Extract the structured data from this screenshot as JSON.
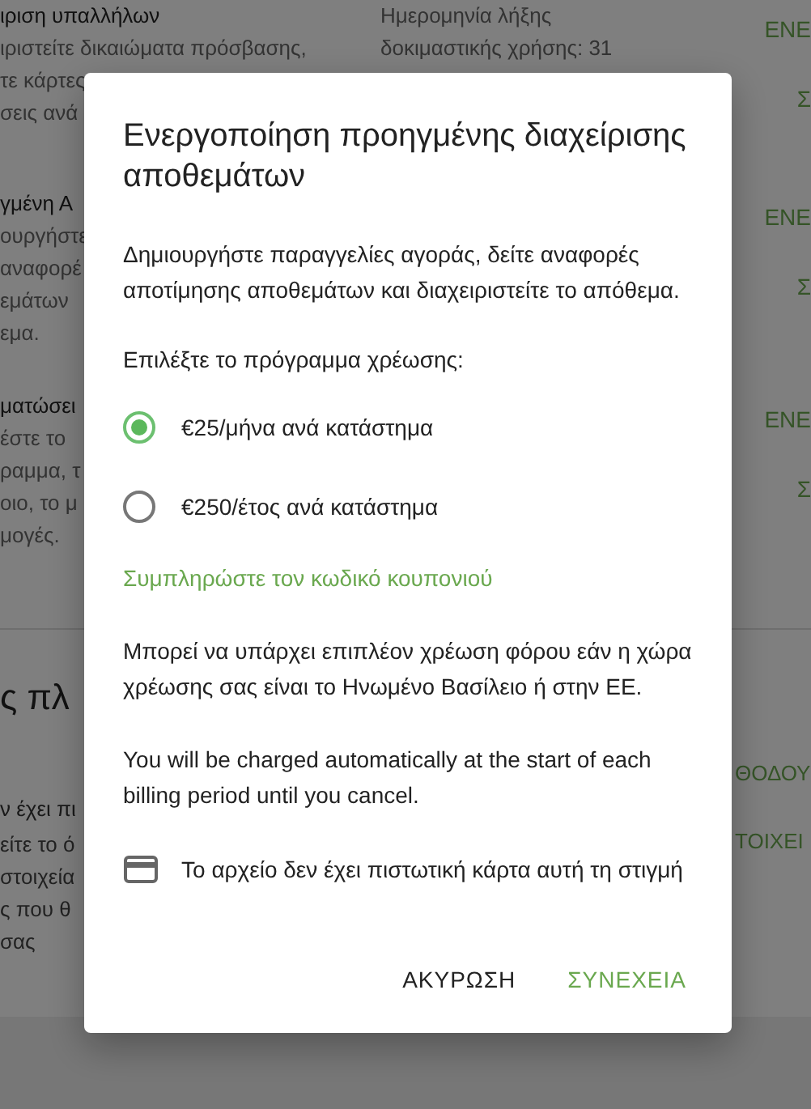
{
  "background": {
    "rows": [
      {
        "lines": [
          "ιριση υπαλλήλων",
          "ιριστείτε δικαιώματα πρόσβασης,",
          "τε κάρτες",
          "σεις ανά"
        ],
        "detail": [
          "Ημερομηνία λήξης",
          "δοκιμαστικής χρήσης: 31"
        ],
        "actions": [
          "ΕΝΕ",
          "Σ"
        ]
      },
      {
        "lines": [
          "γμένη Α",
          "ουργήστε",
          "αναφορέ",
          "εμάτων",
          "εμα."
        ],
        "actions": [
          "ΕΝΕ",
          "Σ"
        ]
      },
      {
        "lines": [
          "ματώσει",
          "έστε το",
          "ραμμα, τ",
          "οιο, το μ",
          "μογές."
        ],
        "actions": [
          "ΕΝΕ",
          "Σ"
        ]
      }
    ],
    "section": {
      "heading": "ς πλ",
      "rows": [
        {
          "lines": [
            "ν έχει πι"
          ],
          "actions": [
            "ΘΟΔΟΥ"
          ]
        },
        {
          "lines": [
            "είτε το ό",
            "στοιχεία",
            "ς που θ",
            "σας"
          ],
          "actions": [
            "ΤΟΙΧΕΙ"
          ]
        }
      ]
    }
  },
  "dialog": {
    "title": "Ενεργοποίηση προηγμένης διαχείρισης αποθεμάτων",
    "description": "Δημιουργήστε παραγγελίες αγοράς, δείτε αναφορές αποτίμησης αποθεμάτων και διαχειριστείτε το απόθεμα.",
    "plan_label": "Επιλέξτε το πρόγραμμα χρέωσης:",
    "plans": [
      {
        "label": "€25/μήνα ανά κατάστημα",
        "selected": true
      },
      {
        "label": "€250/έτος ανά κατάστημα",
        "selected": false
      }
    ],
    "coupon_link": "Συμπληρώστε τον κωδικό κουπονιού",
    "tax_note": "Μπορεί να υπάρχει επιπλέον χρέωση φόρου εάν η χώρα χρέωσης σας είναι το Ηνωμένο Βασίλειο ή στην ΕΕ.",
    "auto_charge_note": "You will be charged automatically at the start of each billing period until you cancel.",
    "card_status": "Το αρχείο δεν έχει πιστωτική κάρτα αυτή τη στιγμή",
    "buttons": [
      {
        "label": "ΑΚΥΡΩΣΗ",
        "kind": "secondary"
      },
      {
        "label": "ΣΥΝΕΧΕΙΑ",
        "kind": "primary"
      }
    ]
  }
}
